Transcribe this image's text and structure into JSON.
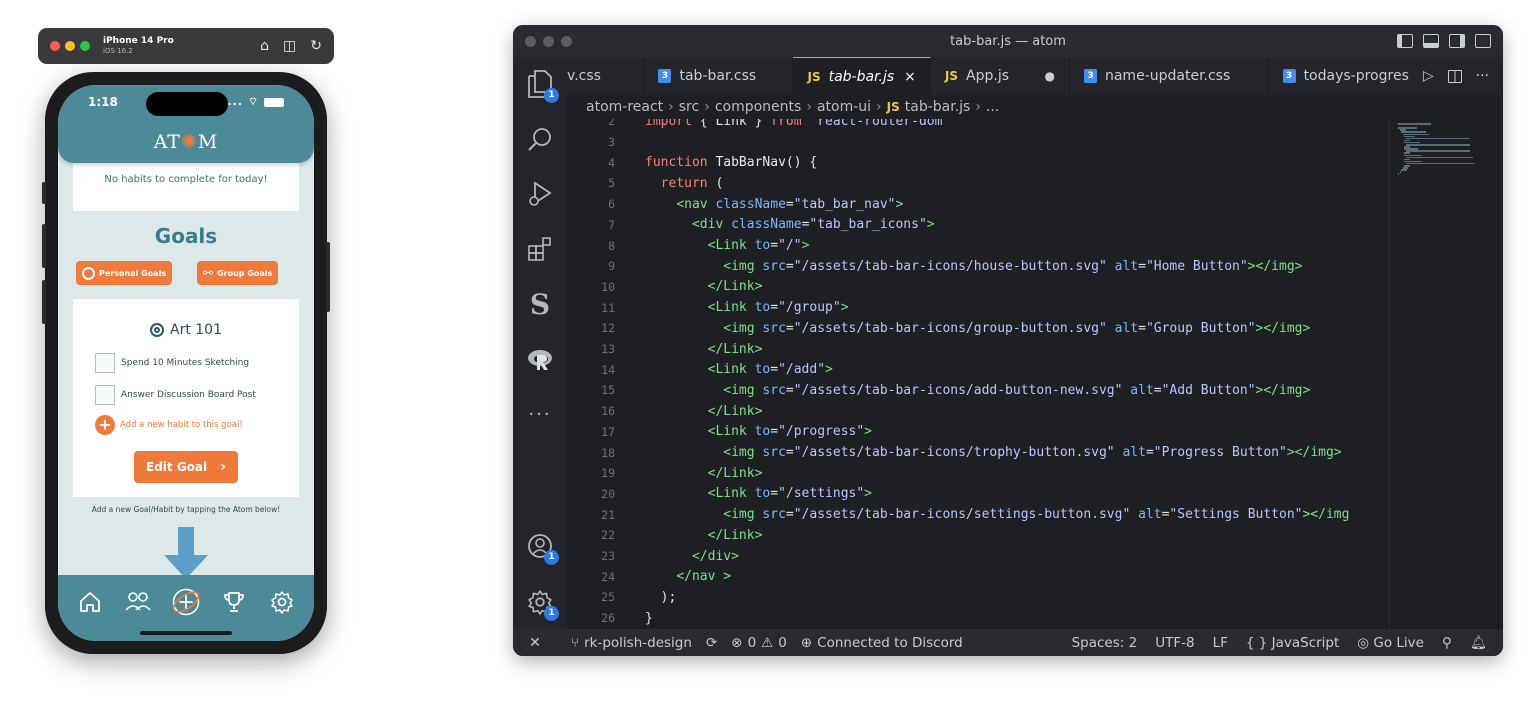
{
  "simulator": {
    "device": "iPhone 14 Pro",
    "os": "iOS 16.2"
  },
  "phone": {
    "status_time": "1:18",
    "status_right": "....",
    "logo_left": "AT",
    "logo_right": "M",
    "top_card_text": "No habits to complete for today!",
    "goals_title": "Goals",
    "personal_goals_label": "Personal Goals",
    "group_goals_label": "Group Goals",
    "goal_name": "Art 101",
    "habits": [
      "Spend 10 Minutes Sketching",
      "Answer Discussion Board Post"
    ],
    "add_habit_label": "Add a new habit to this goal!",
    "edit_goal_label": "Edit Goal",
    "hint": "Add a new Goal/Habit by tapping the Atom below!",
    "accent": "#f07a3c",
    "header_color": "#4d8a98"
  },
  "editor": {
    "window_title": "tab-bar.js — atom",
    "tabs": [
      {
        "label": "v.css",
        "type": "none"
      },
      {
        "label": "tab-bar.css",
        "type": "css"
      },
      {
        "label": "tab-bar.js",
        "type": "js",
        "active": true
      },
      {
        "label": "App.js",
        "type": "js"
      },
      {
        "label": "name-updater.css",
        "type": "css"
      },
      {
        "label": "todays-progres",
        "type": "css"
      }
    ],
    "tab_close": "×",
    "tab_modified": "●",
    "breadcrumb": [
      "atom-react",
      "src",
      "components",
      "atom-ui",
      "tab-bar.js",
      "..."
    ],
    "activity_badges": {
      "explorer": "1",
      "account": "1",
      "settings": "1"
    },
    "code_lines": [
      {
        "n": "2",
        "html": "<span class='kw'>import</span> <span class='pl'>{ Link } </span><span class='kw'>from</span> <span class='str'>'react-router-dom'</span>"
      },
      {
        "n": "3",
        "html": ""
      },
      {
        "n": "4",
        "html": "<span class='kw'>function</span> <span class='fn'>TabBarNav</span><span class='pl'>() {</span>"
      },
      {
        "n": "5",
        "html": "  <span class='kw'>return</span> <span class='pl'>(</span>"
      },
      {
        "n": "6",
        "html": "    <span class='tag'>&lt;nav</span> <span class='attr'>className</span><span class='pl'>=</span><span class='str'>\"tab_bar_nav\"</span><span class='tag'>&gt;</span>"
      },
      {
        "n": "7",
        "html": "      <span class='tag'>&lt;div</span> <span class='attr'>className</span><span class='pl'>=</span><span class='str'>\"tab_bar_icons\"</span><span class='tag'>&gt;</span>"
      },
      {
        "n": "8",
        "html": "        <span class='tag'>&lt;Link</span> <span class='attr'>to</span><span class='pl'>=</span><span class='str'>\"/\"</span><span class='tag'>&gt;</span>"
      },
      {
        "n": "9",
        "html": "          <span class='tag'>&lt;img</span> <span class='attr'>src</span><span class='pl'>=</span><span class='str'>\"/assets/tab-bar-icons/house-button.svg\"</span> <span class='attr'>alt</span><span class='pl'>=</span><span class='str'>\"Home Button\"</span><span class='tag'>&gt;&lt;/img&gt;</span>"
      },
      {
        "n": "10",
        "html": "        <span class='tag'>&lt;/Link&gt;</span>"
      },
      {
        "n": "11",
        "html": "        <span class='tag'>&lt;Link</span> <span class='attr'>to</span><span class='pl'>=</span><span class='str'>\"/group\"</span><span class='tag'>&gt;</span>"
      },
      {
        "n": "12",
        "html": "          <span class='tag'>&lt;img</span> <span class='attr'>src</span><span class='pl'>=</span><span class='str'>\"/assets/tab-bar-icons/group-button.svg\"</span> <span class='attr'>alt</span><span class='pl'>=</span><span class='str'>\"Group Button\"</span><span class='tag'>&gt;&lt;/img&gt;</span>"
      },
      {
        "n": "13",
        "html": "        <span class='tag'>&lt;/Link&gt;</span>"
      },
      {
        "n": "14",
        "html": "        <span class='tag'>&lt;Link</span> <span class='attr'>to</span><span class='pl'>=</span><span class='str'>\"/add\"</span><span class='tag'>&gt;</span>"
      },
      {
        "n": "15",
        "html": "          <span class='tag'>&lt;img</span> <span class='attr'>src</span><span class='pl'>=</span><span class='str'>\"/assets/tab-bar-icons/add-button-new.svg\"</span> <span class='attr'>alt</span><span class='pl'>=</span><span class='str'>\"Add Button\"</span><span class='tag'>&gt;&lt;/img&gt;</span>"
      },
      {
        "n": "16",
        "html": "        <span class='tag'>&lt;/Link&gt;</span>"
      },
      {
        "n": "17",
        "html": "        <span class='tag'>&lt;Link</span> <span class='attr'>to</span><span class='pl'>=</span><span class='str'>\"/progress\"</span><span class='tag'>&gt;</span>"
      },
      {
        "n": "18",
        "html": "          <span class='tag'>&lt;img</span> <span class='attr'>src</span><span class='pl'>=</span><span class='str'>\"/assets/tab-bar-icons/trophy-button.svg\"</span> <span class='attr'>alt</span><span class='pl'>=</span><span class='str'>\"Progress Button\"</span><span class='tag'>&gt;&lt;/img&gt;</span>"
      },
      {
        "n": "19",
        "html": "        <span class='tag'>&lt;/Link&gt;</span>"
      },
      {
        "n": "20",
        "html": "        <span class='tag'>&lt;Link</span> <span class='attr'>to</span><span class='pl'>=</span><span class='str'>\"/settings\"</span><span class='tag'>&gt;</span>"
      },
      {
        "n": "21",
        "html": "          <span class='tag'>&lt;img</span> <span class='attr'>src</span><span class='pl'>=</span><span class='str'>\"/assets/tab-bar-icons/settings-button.svg\"</span> <span class='attr'>alt</span><span class='pl'>=</span><span class='str'>\"Settings Button\"</span><span class='tag'>&gt;&lt;/img</span>"
      },
      {
        "n": "22",
        "html": "        <span class='tag'>&lt;/Link&gt;</span>"
      },
      {
        "n": "23",
        "html": "      <span class='tag'>&lt;/div&gt;</span>"
      },
      {
        "n": "24",
        "html": "    <span class='tag'>&lt;/nav</span> <span class='tag'>&gt;</span>"
      },
      {
        "n": "25",
        "html": "  <span class='pl'>);</span>"
      },
      {
        "n": "26",
        "html": "<span class='pl'>}</span>"
      }
    ],
    "status": {
      "branch": "rk-polish-design",
      "errors": "0",
      "warnings": "0",
      "discord": "Connected to Discord",
      "spaces": "Spaces: 2",
      "encoding": "UTF-8",
      "eol": "LF",
      "language": "{ } JavaScript",
      "golive": "Go Live"
    }
  }
}
